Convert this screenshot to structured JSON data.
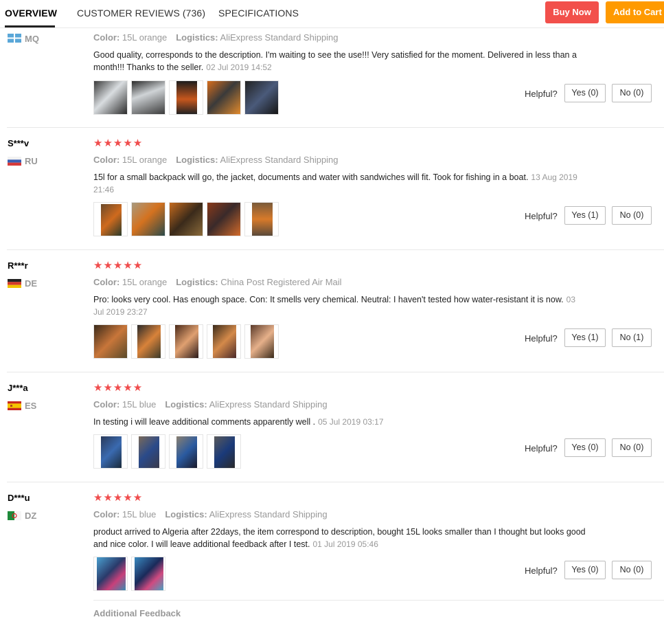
{
  "tabs": {
    "overview": "OVERVIEW",
    "reviews": "CUSTOMER REVIEWS (736)",
    "specifications": "SPECIFICATIONS"
  },
  "actions": {
    "buy_now": "Buy Now",
    "add_to_cart": "Add to Cart"
  },
  "labels": {
    "color": "Color:",
    "logistics": "Logistics:",
    "helpful": "Helpful?",
    "additional_feedback": "Additional Feedback"
  },
  "reviews": [
    {
      "user": "",
      "country": "MQ",
      "color": "15L orange",
      "logistics": "AliExpress Standard Shipping",
      "text": "Good quality, corresponds to the description. I'm waiting to see the use!!! Very satisfied for the moment. Delivered in less than a month!!! Thanks to the seller.",
      "date": "02 Jul 2019 14:52",
      "yes": "Yes (0)",
      "no": "No (0)"
    },
    {
      "user": "S***v",
      "country": "RU",
      "stars": "★★★★★",
      "color": "15L orange",
      "logistics": "AliExpress Standard Shipping",
      "text": "15l for a small backpack will go, the jacket, documents and water with sandwiches will fit. Took for fishing in a boat.",
      "date": "13 Aug 2019 21:46",
      "yes": "Yes (1)",
      "no": "No (0)"
    },
    {
      "user": "R***r",
      "country": "DE",
      "stars": "★★★★★",
      "color": "15L orange",
      "logistics": "China Post Registered Air Mail",
      "text": "Pro: looks very cool. Has enough space. Con: It smells very chemical. Neutral: I haven't tested how water-resistant it is now.",
      "date": "03 Jul 2019 23:27",
      "yes": "Yes (1)",
      "no": "No (1)"
    },
    {
      "user": "J***a",
      "country": "ES",
      "stars": "★★★★★",
      "color": "15L blue",
      "logistics": "AliExpress Standard Shipping",
      "text": "In testing i will leave additional comments apparently well .",
      "date": "05 Jul 2019 03:17",
      "yes": "Yes (0)",
      "no": "No (0)"
    },
    {
      "user": "D***u",
      "country": "DZ",
      "stars": "★★★★★",
      "color": "15L blue",
      "logistics": "AliExpress Standard Shipping",
      "text": "product arrived to Algeria after 22days, the item correspond to description, bought 15L looks smaller than I thought but looks good and nice color. I will leave additional feedback after I test.",
      "date": "01 Jul 2019 05:46",
      "yes": "Yes (0)",
      "no": "No (0)"
    }
  ],
  "colors": {
    "accent_red": "#f2504b",
    "accent_orange": "#ff9a00",
    "star": "#f04d4d"
  }
}
